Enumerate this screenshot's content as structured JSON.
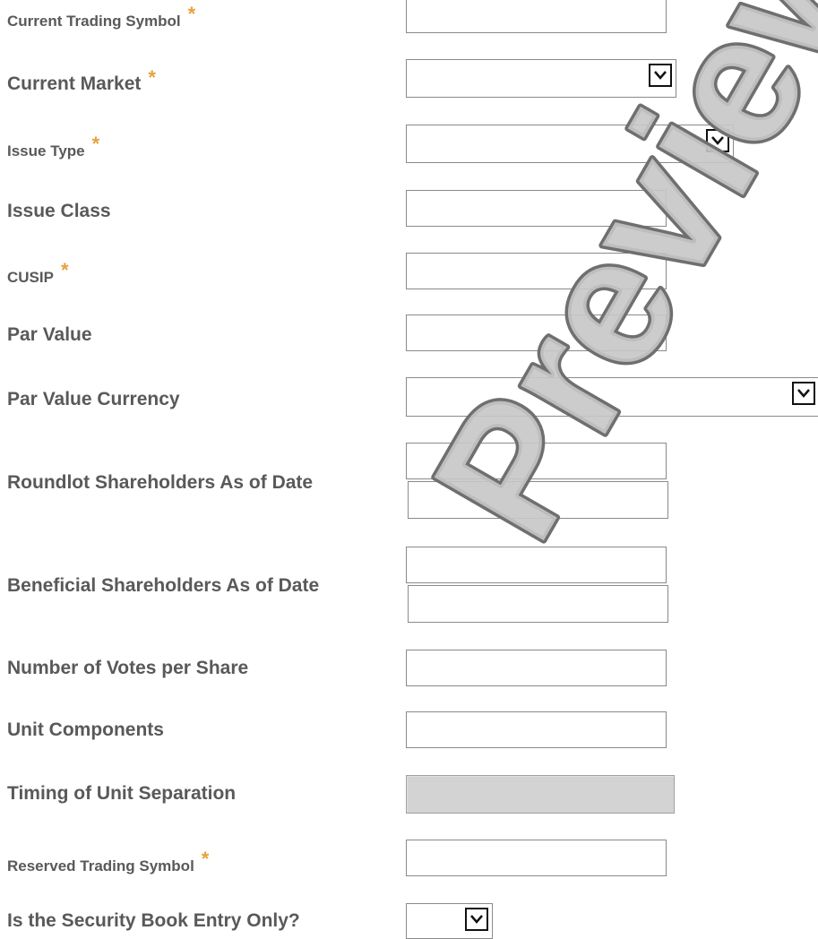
{
  "fields": [
    {
      "label": "Current Trading Symbol",
      "required": "*"
    },
    {
      "label": "Current Market",
      "required": "*"
    },
    {
      "label": "Issue Type",
      "required": "*"
    },
    {
      "label": "Issue Class"
    },
    {
      "label": "CUSIP",
      "required": "*"
    },
    {
      "label": "Par Value"
    },
    {
      "label": "Par Value Currency"
    },
    {
      "label": "Roundlot Shareholders As of Date"
    },
    {
      "label": "Beneficial Shareholders As of Date"
    },
    {
      "label": "Number of Votes per Share"
    },
    {
      "label": "Unit Components"
    },
    {
      "label": "Timing of Unit Separation"
    },
    {
      "label": "Reserved Trading Symbol",
      "required": "*"
    },
    {
      "label": "Is the Security Book Entry Only?"
    }
  ],
  "watermark": {
    "text": "Preview"
  },
  "icons": {
    "dropdown": "chevron-down-icon"
  },
  "colors": {
    "required_asterisk": "#e6a23c",
    "label": "#595959",
    "disabled_field": "#d3d3d3"
  }
}
